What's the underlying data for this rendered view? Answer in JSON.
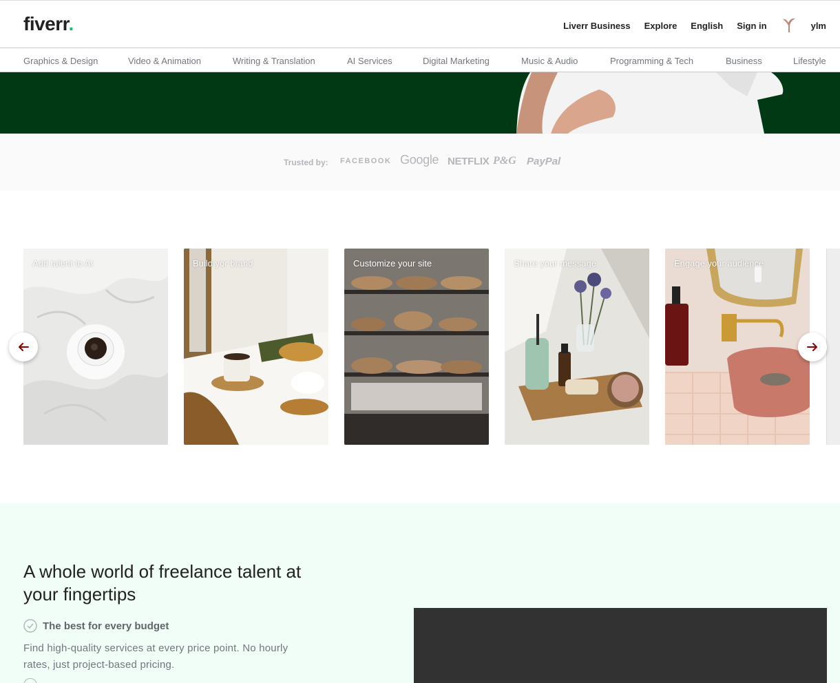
{
  "header": {
    "logo": "fiverr",
    "logo_dot": ".",
    "nav": {
      "business": "Liverr Business",
      "explore": "Explore",
      "language": "English",
      "sign_in": "Sign in",
      "user": "ylm"
    }
  },
  "categories": [
    "Graphics & Design",
    "Video & Animation",
    "Writing & Translation",
    "AI Services",
    "Digital Marketing",
    "Music & Audio",
    "Programming & Tech",
    "Business",
    "Lifestyle"
  ],
  "trusted": {
    "label": "Trusted by:",
    "brands": [
      "FACEBOOK",
      "Google",
      "NETFLIX",
      "P&G",
      "PayPal"
    ]
  },
  "carousel": {
    "cards": [
      "Add talent to AI",
      "Build yor brand",
      "Customize your site",
      "Share your message",
      "Engage your audience"
    ]
  },
  "features": {
    "title": "A whole world of freelance talent at your fingertips",
    "item1_title": "The best for every budget",
    "item1_desc": "Find high-quality services at every price point. No hourly rates, just project-based pricing."
  },
  "colors": {
    "brand_green": "#1dbf73",
    "hero_green": "#013914",
    "arrow": "#8b0000",
    "feature_bg": "#f1fdf7"
  }
}
